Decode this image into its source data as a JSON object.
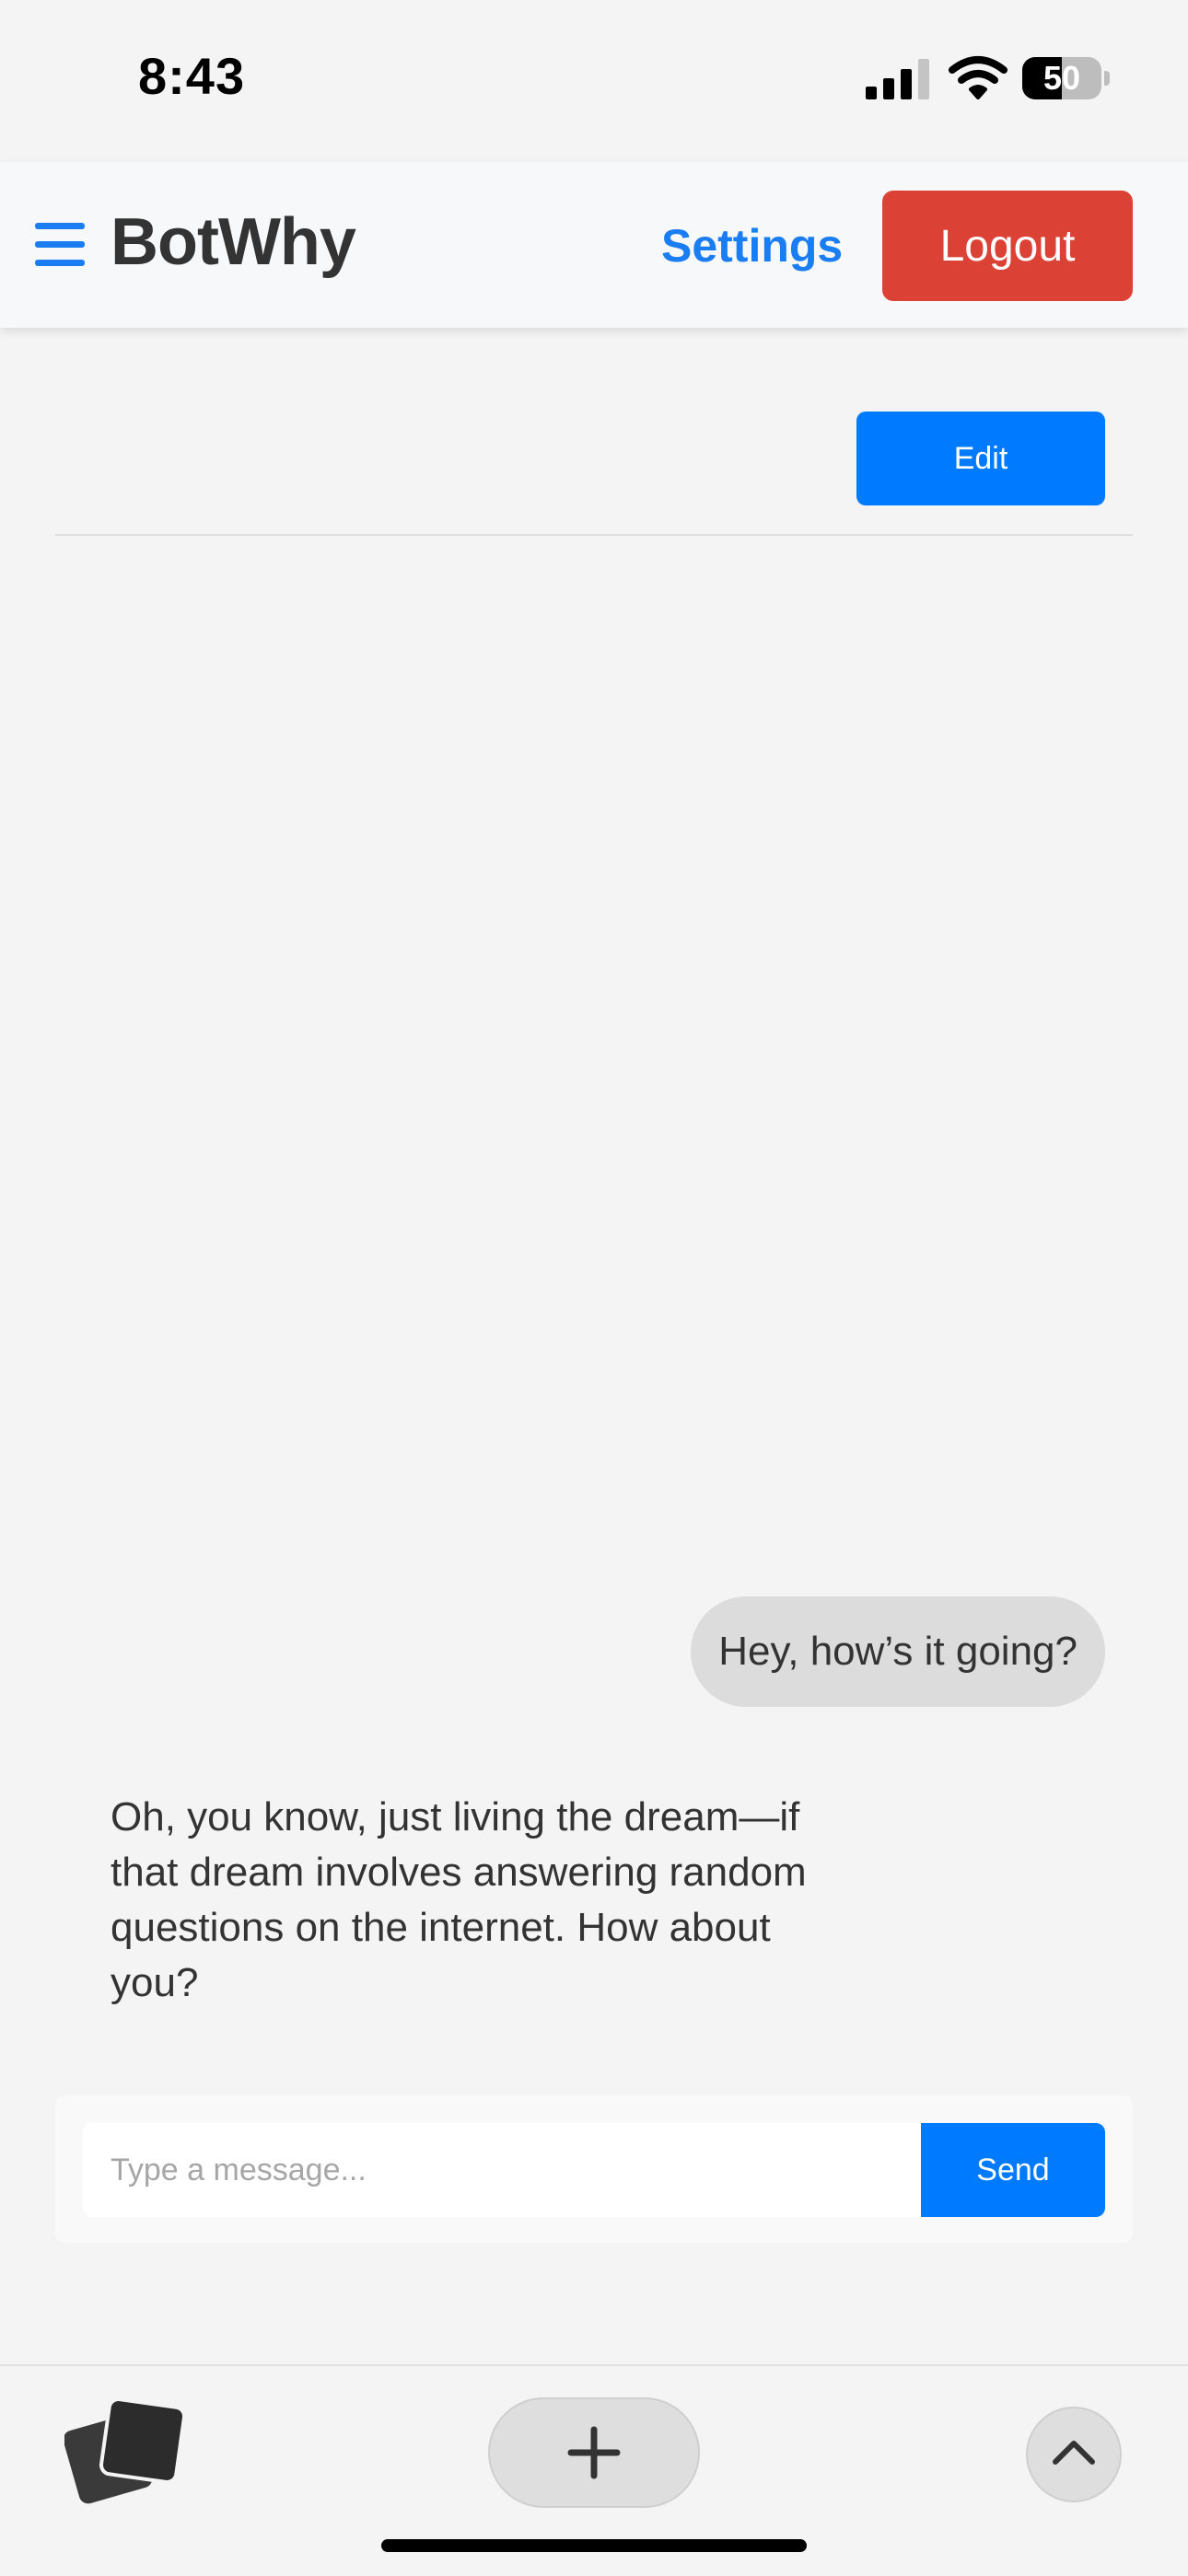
{
  "status_bar": {
    "time": "8:43",
    "battery_percent": "50",
    "battery_level": 0.5
  },
  "header": {
    "menu_icon": "hamburger-menu-icon",
    "title": "BotWhy",
    "settings_label": "Settings",
    "logout_label": "Logout"
  },
  "toolbar": {
    "edit_label": "Edit"
  },
  "chat": {
    "messages": [
      {
        "role": "user",
        "text": "Hey, how’s it going?"
      },
      {
        "role": "bot",
        "text": "Oh, you know, just living the dream—if that dream involves answering random questions on the internet. How about you?"
      }
    ]
  },
  "composer": {
    "placeholder": "Type a message...",
    "value": "",
    "send_label": "Send"
  },
  "bottom_bar": {
    "icons": [
      "tabs-icon",
      "plus-icon",
      "chevron-up-icon"
    ]
  },
  "colors": {
    "accent": "#007bff",
    "link": "#1a7ef2",
    "danger": "#dc4135",
    "background": "#f4f4f4",
    "bubble": "#dcdcdc"
  }
}
